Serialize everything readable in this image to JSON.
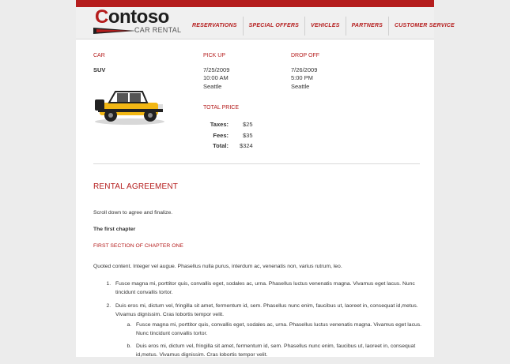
{
  "brand": {
    "name_c": "C",
    "name_rest": "ontoso",
    "tagline": "CAR RENTAL"
  },
  "nav": [
    {
      "label": "RESERVATIONS"
    },
    {
      "label": "SPECIAL OFFERS"
    },
    {
      "label": "VEHICLES"
    },
    {
      "label": "PARTNERS"
    },
    {
      "label": "CUSTOMER SERVICE"
    }
  ],
  "booking": {
    "car_label": "CAR",
    "car_value": "SUV",
    "pickup_label": "PICK UP",
    "pickup_date": "7/25/2009",
    "pickup_time": "10:00  AM",
    "pickup_city": "Seattle",
    "dropoff_label": "DROP OFF",
    "dropoff_date": "7/26/2009",
    "dropoff_time": "5:00  PM",
    "dropoff_city": "Seattle",
    "total_price_label": "TOTAL PRICE",
    "taxes_label": "Taxes:",
    "taxes_value": "$25",
    "fees_label": "Fees:",
    "fees_value": "$35",
    "total_label": "Total:",
    "total_value": "$324"
  },
  "agreement": {
    "title": "RENTAL AGREEMENT",
    "instruction": "Scroll down to agree and finalize.",
    "chapter": "The first chapter",
    "section": "FIRST SECTION OF CHAPTER ONE",
    "quote": "Quoted content. Integer vel augue. Phasellus nulla purus, interdum ac, venenatis non, varius rutrum, leo.",
    "item1": "Fusce magna mi, porttitor quis, convallis eget, sodales ac, urna. Phasellus luctus venenatis magna. Vivamus eget lacus. Nunc tincidunt convallis tortor.",
    "item2": "Duis eros mi, dictum vel, fringilla sit amet, fermentum id, sem. Phasellus nunc enim, faucibus ut, laoreet in, consequat id,metus. Vivamus dignissim. Cras lobortis tempor velit.",
    "sub_a": "Fusce magna mi, porttitor quis, convallis eget, sodales ac, urna. Phasellus luctus venenatis magna. Vivamus eget lacus. Nunc tincidunt convallis tortor.",
    "sub_b": "Duis eros mi, dictum vel, fringilla sit amet, fermentum id, sem. Phasellus nunc enim, faucibus ut, laoreet in, consequat id,metus. Vivamus dignissim. Cras lobortis tempor velit."
  },
  "colors": {
    "accent": "#b51d1d",
    "background": "#ececec"
  }
}
